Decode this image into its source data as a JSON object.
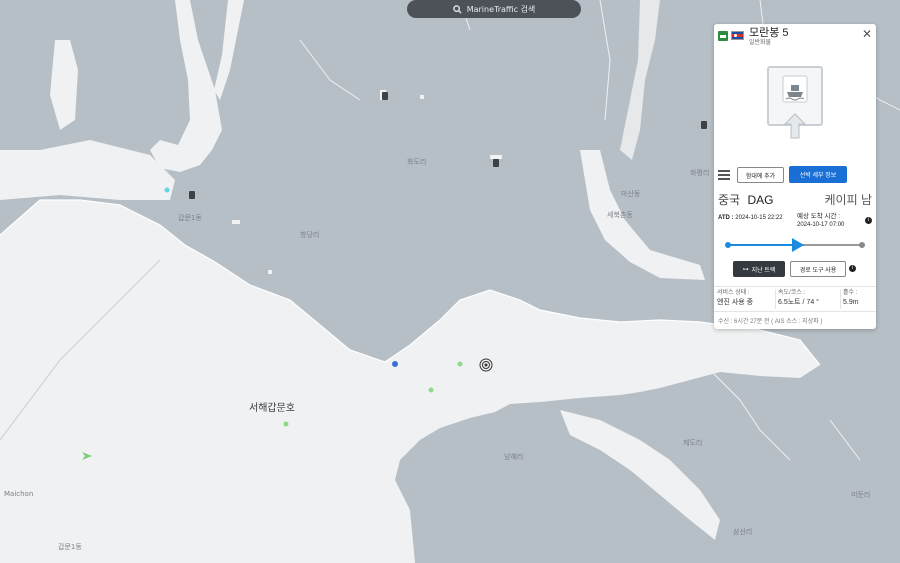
{
  "search": {
    "placeholder": "MarineTraffic 검색"
  },
  "map": {
    "colors": {
      "land": "#b7bfc6",
      "water": "#f0f1f2",
      "land_border": "#ffffff"
    },
    "labels": {
      "west_sea_lock": "서해갑문호",
      "hwadori": "화도리",
      "hwadori2": "화도리",
      "gapmun1": "갑문1동",
      "gapmun1b": "갑문1동",
      "hangdangri": "항당리",
      "masanri": "마산동",
      "sebukdong": "세북촌동",
      "hwapyeong": "화평리",
      "jedori": "제도리",
      "samseonri": "삼선리",
      "midori": "미둔리",
      "namhyeri": "남혜리",
      "maichon": "Maichon"
    },
    "markers": [
      {
        "name": "vessel-cyan",
        "color": "#5fd7e0",
        "shape": "dot"
      },
      {
        "name": "vessel-blue",
        "color": "#3b6fd0",
        "shape": "dot"
      },
      {
        "name": "vessel-green-1",
        "color": "#8fd98a",
        "shape": "dot"
      },
      {
        "name": "vessel-green-2",
        "color": "#8fd98a",
        "shape": "dot"
      },
      {
        "name": "vessel-green-3",
        "color": "#8fd98a",
        "shape": "dot"
      },
      {
        "name": "vessel-green-arrow",
        "color": "#7fcf7a",
        "shape": "arrow"
      },
      {
        "name": "selected-vessel",
        "color": "#333333",
        "shape": "target"
      }
    ]
  },
  "vessel": {
    "name": "모란봉 5",
    "type": "일반화물",
    "flag_icon": "north-korea-flag",
    "type_icon": "cargo-ship-icon",
    "buttons": {
      "add_fleet": "함대에 추가",
      "details": "선박 세부 정보",
      "past_track": "지난 트랙",
      "route_tool": "경로 도구 사용"
    },
    "route": {
      "from_country": "중국",
      "from_port": "DAG",
      "to_port": "케이피 남"
    },
    "atd_label": "ATD :",
    "atd_value": "2024-10-15 22:22",
    "eta_label": "예상 도착 시간 :",
    "eta_value": "2024-10-17 07:00",
    "progress": 0.52,
    "stats": {
      "status_label": "서비스 상태 :",
      "status_value": "엔진 사용 중",
      "speed_label": "속도/코스 :",
      "speed_value": "6.5노트 / 74 °",
      "draught_label": "흘수 :",
      "draught_value": "5.9m"
    },
    "received": "수신 : 6시간 27분 전 ( AIS 소스 : 지상파 )"
  }
}
